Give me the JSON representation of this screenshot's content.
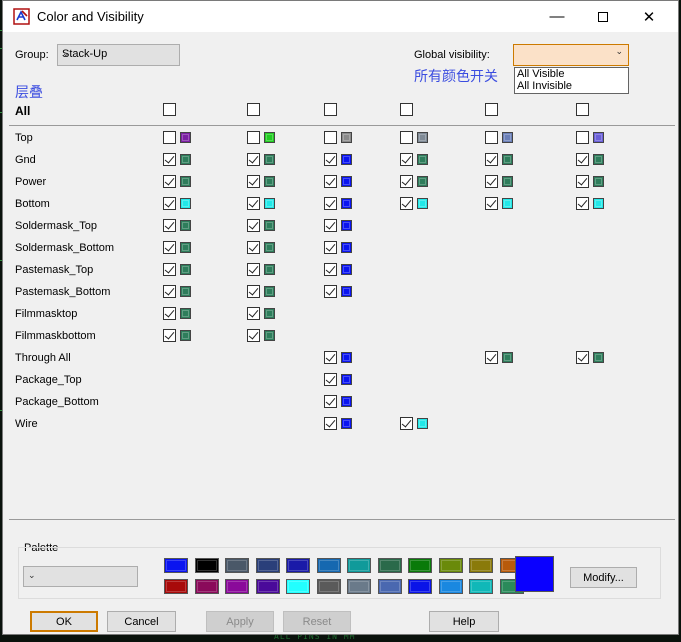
{
  "window": {
    "title": "Color and Visibility"
  },
  "group": {
    "label": "Group:",
    "value": "Stack-Up"
  },
  "global_visibility": {
    "label": "Global visibility:",
    "value": "",
    "options": [
      "All Visible",
      "All Invisible"
    ]
  },
  "annotations": {
    "stackup_cn": "层叠",
    "switch_cn": "所有颜色开关"
  },
  "all_row": {
    "label": "All"
  },
  "columns_x": [
    168,
    252,
    329,
    405,
    490,
    581
  ],
  "layers": [
    {
      "name": "Top",
      "cells": [
        {
          "checked": false,
          "color": "#7b1fa2"
        },
        {
          "checked": false,
          "color": "#22cc22"
        },
        {
          "checked": false,
          "color": "#8a8a8a"
        },
        {
          "checked": false,
          "color": "#7f8a96"
        },
        {
          "checked": false,
          "color": "#6a7fb8"
        },
        {
          "checked": false,
          "color": "#6a5fd8"
        }
      ]
    },
    {
      "name": "Gnd",
      "cells": [
        {
          "checked": true,
          "color": "#2e7d5b"
        },
        {
          "checked": true,
          "color": "#2e7d5b"
        },
        {
          "checked": true,
          "color": "#0a14f0"
        },
        {
          "checked": true,
          "color": "#2e7d5b"
        },
        {
          "checked": true,
          "color": "#2e7d5b"
        },
        {
          "checked": true,
          "color": "#2e7d5b"
        }
      ]
    },
    {
      "name": "Power",
      "cells": [
        {
          "checked": true,
          "color": "#2e7d5b"
        },
        {
          "checked": true,
          "color": "#2e7d5b"
        },
        {
          "checked": true,
          "color": "#0a14f0"
        },
        {
          "checked": true,
          "color": "#2e7d5b"
        },
        {
          "checked": true,
          "color": "#2e7d5b"
        },
        {
          "checked": true,
          "color": "#2e7d5b"
        }
      ]
    },
    {
      "name": "Bottom",
      "cells": [
        {
          "checked": true,
          "color": "#22e8e8"
        },
        {
          "checked": true,
          "color": "#22e8e8"
        },
        {
          "checked": true,
          "color": "#0a14f0"
        },
        {
          "checked": true,
          "color": "#22e8e8"
        },
        {
          "checked": true,
          "color": "#22e8e8"
        },
        {
          "checked": true,
          "color": "#22e8e8"
        }
      ]
    },
    {
      "name": "Soldermask_Top",
      "cells": [
        {
          "checked": true,
          "color": "#2e7d5b"
        },
        {
          "checked": true,
          "color": "#2e7d5b"
        },
        {
          "checked": true,
          "color": "#0a14f0"
        },
        null,
        null,
        null
      ]
    },
    {
      "name": "Soldermask_Bottom",
      "cells": [
        {
          "checked": true,
          "color": "#2e7d5b"
        },
        {
          "checked": true,
          "color": "#2e7d5b"
        },
        {
          "checked": true,
          "color": "#0a14f0"
        },
        null,
        null,
        null
      ]
    },
    {
      "name": "Pastemask_Top",
      "cells": [
        {
          "checked": true,
          "color": "#2e7d5b"
        },
        {
          "checked": true,
          "color": "#2e7d5b"
        },
        {
          "checked": true,
          "color": "#0a14f0"
        },
        null,
        null,
        null
      ]
    },
    {
      "name": "Pastemask_Bottom",
      "cells": [
        {
          "checked": true,
          "color": "#2e7d5b"
        },
        {
          "checked": true,
          "color": "#2e7d5b"
        },
        {
          "checked": true,
          "color": "#0a14f0"
        },
        null,
        null,
        null
      ]
    },
    {
      "name": "Filmmasktop",
      "cells": [
        {
          "checked": true,
          "color": "#2e7d5b"
        },
        {
          "checked": true,
          "color": "#2e7d5b"
        },
        null,
        null,
        null,
        null
      ]
    },
    {
      "name": "Filmmaskbottom",
      "cells": [
        {
          "checked": true,
          "color": "#2e7d5b"
        },
        {
          "checked": true,
          "color": "#2e7d5b"
        },
        null,
        null,
        null,
        null
      ]
    },
    {
      "name": "Through All",
      "cells": [
        null,
        null,
        {
          "checked": true,
          "color": "#0a14f0"
        },
        null,
        {
          "checked": true,
          "color": "#2e7d5b"
        },
        {
          "checked": true,
          "color": "#2e7d5b"
        }
      ]
    },
    {
      "name": "Package_Top",
      "cells": [
        null,
        null,
        {
          "checked": true,
          "color": "#0a14f0"
        },
        null,
        null,
        null
      ]
    },
    {
      "name": "Package_Bottom",
      "cells": [
        null,
        null,
        {
          "checked": true,
          "color": "#0a14f0"
        },
        null,
        null,
        null
      ]
    },
    {
      "name": "Wire",
      "cells": [
        null,
        null,
        {
          "checked": true,
          "color": "#0a14f0"
        },
        {
          "checked": true,
          "color": "#22e8e8"
        },
        null,
        null
      ]
    }
  ],
  "palette": {
    "label": "Palette",
    "combo_value": "",
    "row1": [
      "#0a14f0",
      "#000000",
      "#4a5868",
      "#2a3f7a",
      "#1a1aa8",
      "#1668b0",
      "#109a9a",
      "#2a6a4a",
      "#0a7a0a",
      "#6a8a0a",
      "#8a7a0a",
      "#b85a0a"
    ],
    "row2": [
      "#a80a0a",
      "#8a0a5a",
      "#8a0a9a",
      "#4a0a9a",
      "#22ffff",
      "#5a5a5a",
      "#6a7a8a",
      "#4a68b0",
      "#0a14e8",
      "#1a88e0",
      "#10b8b8",
      "#2a8a5a"
    ],
    "selected_color": "#0a00ff"
  },
  "buttons": {
    "modify": "Modify...",
    "ok": "OK",
    "cancel": "Cancel",
    "apply": "Apply",
    "reset": "Reset",
    "help": "Help"
  },
  "background": {
    "status_text": "ALL  PINS  IN  MM"
  }
}
